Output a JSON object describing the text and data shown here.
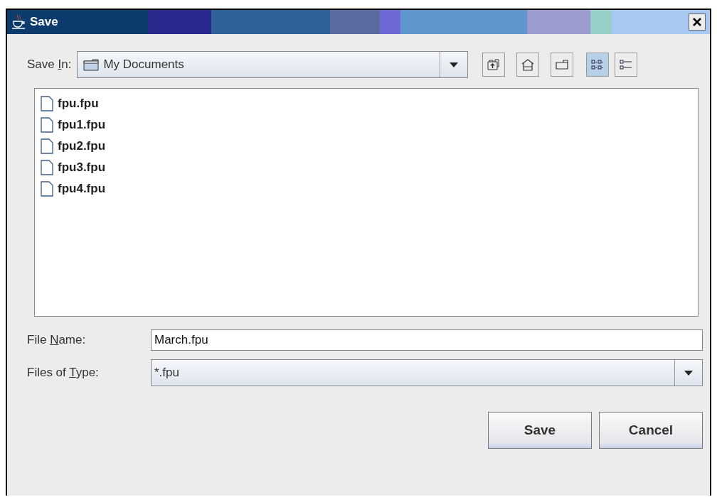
{
  "window": {
    "title": "Save"
  },
  "save_in": {
    "label": {
      "before": "Save ",
      "key": "I",
      "after": "n:"
    },
    "value": "My Documents"
  },
  "toolbar": [
    {
      "kind": "up"
    },
    {
      "kind": "home"
    },
    {
      "kind": "new-folder"
    },
    {
      "kind": "list",
      "selected": true
    },
    {
      "kind": "details",
      "selected": false
    }
  ],
  "files": [
    {
      "name": "fpu.fpu"
    },
    {
      "name": "fpu1.fpu"
    },
    {
      "name": "fpu2.fpu"
    },
    {
      "name": "fpu3.fpu"
    },
    {
      "name": "fpu4.fpu"
    }
  ],
  "file_name": {
    "label": {
      "before": "File ",
      "key": "N",
      "after": "ame:"
    },
    "value": "March.fpu"
  },
  "file_type": {
    "label": {
      "before": "Files of ",
      "key": "T",
      "after": "ype:"
    },
    "value": "*.fpu"
  },
  "buttons": [
    "Save",
    "Cancel"
  ]
}
